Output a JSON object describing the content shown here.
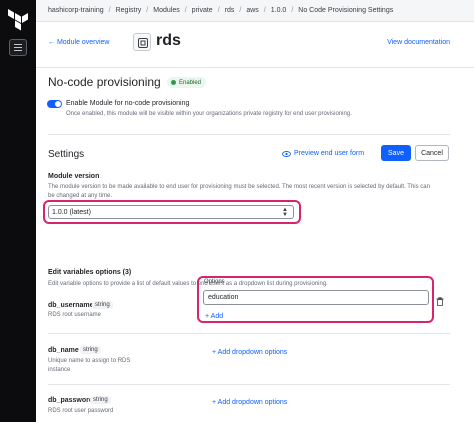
{
  "breadcrumb": [
    {
      "label": "hashicorp-training"
    },
    {
      "label": "Registry"
    },
    {
      "label": "Modules"
    },
    {
      "label": "private"
    },
    {
      "label": "rds"
    },
    {
      "label": "aws"
    },
    {
      "label": "1.0.0"
    },
    {
      "label": "No Code Provisioning Settings"
    }
  ],
  "header": {
    "back_label": "Module overview",
    "module_name": "rds",
    "view_doc_label": "View documentation"
  },
  "no_code": {
    "title": "No-code provisioning",
    "badge": "Enabled",
    "toggle_label": "Enable Module for no-code provisioning",
    "toggle_help": "Once enabled, this module will be visible within your organizations private registry for end user provisioning.",
    "toggle_on": true
  },
  "settings": {
    "title": "Settings",
    "preview_label": "Preview end user form",
    "save_label": "Save",
    "cancel_label": "Cancel"
  },
  "module_version": {
    "label": "Module version",
    "help": "The module version to be made available to end user for provisioning must be selected. The most recent version is selected by default. This can be changed at any time.",
    "selected": "1.0.0 (latest)"
  },
  "edit_variables": {
    "title": "Edit variables options (3)",
    "help": "Edit variable options to provide a list of default values to end users as a dropdown list during provisioning."
  },
  "variables": [
    {
      "name": "db_username",
      "type": "string",
      "description": "RDS root username",
      "options_label": "Options",
      "option_value": "education",
      "add_label": "+ Add"
    },
    {
      "name": "db_name",
      "type": "string",
      "description": "Unique name to assign to RDS instance",
      "add_label": "+ Add dropdown options"
    },
    {
      "name": "db_password",
      "type": "string",
      "description": "RDS root user password",
      "add_label": "+ Add dropdown options"
    }
  ],
  "colors": {
    "accent": "#1060ff",
    "highlight": "#d6246e",
    "sidebar": "#0c0c0e",
    "badge_green": "#19692c"
  }
}
